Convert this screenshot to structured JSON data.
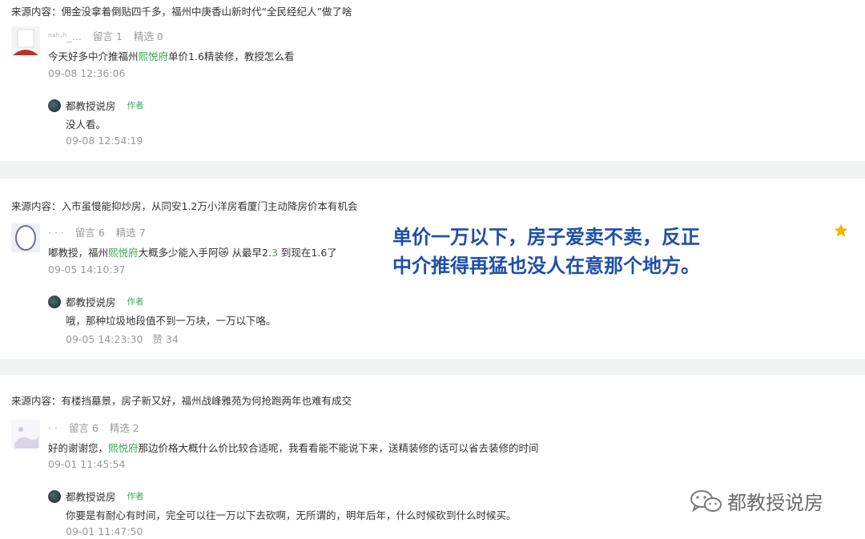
{
  "comments": [
    {
      "source": "来源内容：佣金没拿着倒贴四千多，福州中庚香山新时代“全民经纪人”做了啥",
      "user_name": "ⁿˢʰ·ʰ_...",
      "replies_count": "留言 1",
      "featured_count": "精选 0",
      "text_before": "今天好多中介推福州",
      "text_highlight": "熙悦府",
      "text_after": "单价1.6精装修，教授怎么看",
      "time": "09-08 12:36:06",
      "reply": {
        "author": "都教授说房",
        "tag": "作者",
        "text": "没人看。",
        "time": "09-08 12:54:19",
        "likes": ""
      }
    },
    {
      "source": "来源内容：入市虽慢能抑炒房，从同安1.2万小洋房看厦门主动降房价本有机会",
      "user_name": "· · ·",
      "replies_count": "留言 6",
      "featured_count": "精选 7",
      "text_before": "嘟教授，福州",
      "text_highlight": "熙悦府",
      "text_after": "大概多少能入手阿😿 从最早2.",
      "text_highlight2": "3",
      "text_after2": " 到现在1.6了",
      "time": "09-05 14:10:37",
      "reply": {
        "author": "都教授说房",
        "tag": "作者",
        "text": "哦，那种垃圾地段值不到一万块，一万以下咯。",
        "time": "09-05 14:23:30",
        "likes": "赞 34"
      }
    },
    {
      "source": "来源内容：有楼挡墓景，房子新又好，福州战峰雅苑为何抢跑两年也难有成交",
      "user_name": "· ·",
      "replies_count": "留言 6",
      "featured_count": "精选 2",
      "text_before": "好的谢谢您，",
      "text_highlight": "熙悦府",
      "text_after": "那边价格大概什么价比较合适呢，我看看能不能说下来，送精装修的话可以省去装修的时间",
      "time": "09-01 11:45:54",
      "reply": {
        "author": "都教授说房",
        "tag": "作者",
        "text": "你要是有耐心有时间，完全可以往一万以下去砍啊，无所谓的，明年后年，什么时候砍到什么时候买。",
        "time": "09-01 11:47:50",
        "likes": ""
      }
    }
  ],
  "overlay": {
    "line1": "单价一万以下，房子爱卖不卖，反正",
    "line2": "中介推得再猛也没人在意那个地方。"
  },
  "watermark": {
    "text": "都教授说房",
    "icon": "wechat-icon"
  },
  "colors": {
    "highlight": "#3aa655",
    "overlay_text": "#1f4fa8",
    "star": "#f5b400",
    "divider": "#f2f3f5"
  }
}
